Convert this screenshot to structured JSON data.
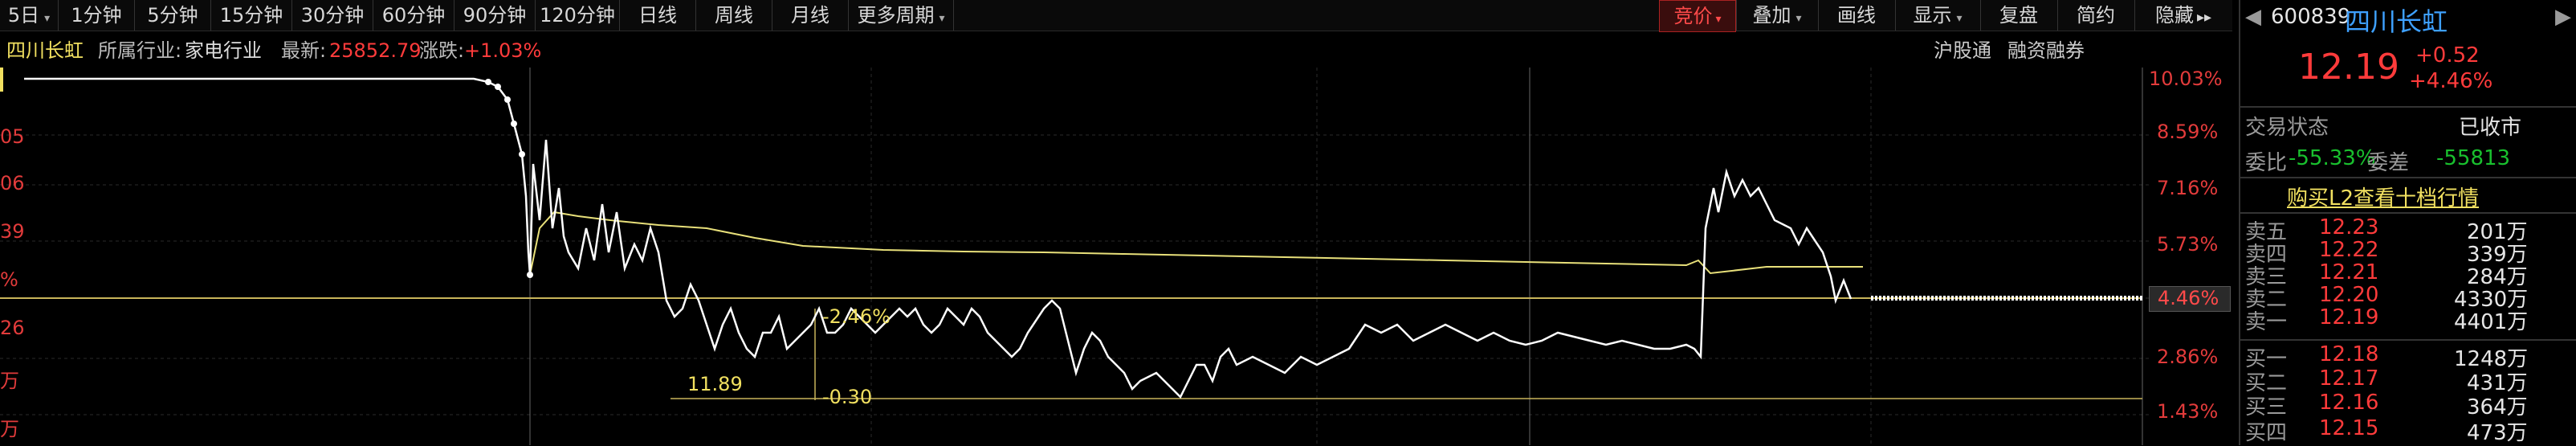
{
  "toolbar": {
    "periods": [
      "5日",
      "1分钟",
      "5分钟",
      "15分钟",
      "30分钟",
      "60分钟",
      "90分钟",
      "120分钟",
      "日线",
      "周线",
      "月线",
      "更多周期"
    ],
    "right_buttons": [
      "竞价",
      "叠加",
      "画线",
      "显示",
      "复盘",
      "简约",
      "隐藏"
    ]
  },
  "infobar": {
    "stock_name": "四川长虹",
    "industry_label": "所属行业:",
    "industry": "家电行业",
    "latest_label": "最新:",
    "latest": "25852.79",
    "change_label": "涨跌:",
    "change": "+1.03%",
    "right_links": [
      "沪股通",
      "融资融券"
    ]
  },
  "chart": {
    "right_axis": [
      "10.03%",
      "8.59%",
      "7.16%",
      "5.73%",
      "4.46%",
      "2.86%",
      "1.43%"
    ],
    "left_axis": [
      "05",
      "06",
      "39",
      "%",
      "26",
      "万",
      "万"
    ],
    "annotations": {
      "pct": "-2.46%",
      "low_price": "11.89",
      "delta": "-0.30"
    },
    "colors": {
      "price_line": "#ffffff",
      "avg_line": "#e8e07a",
      "axis_text": "#e23b3b"
    }
  },
  "panel": {
    "code": "600839",
    "name": "四川长虹",
    "price": "12.19",
    "change": "+0.52",
    "change_pct": "+4.46%",
    "status_label": "交易状态",
    "status": "已收市",
    "wb_label": "委比",
    "wb": "-55.33%",
    "wc_label": "委差",
    "wc": "-55813",
    "l2_link": "购买L2查看十档行情",
    "asks": [
      {
        "label": "卖五",
        "price": "12.23",
        "vol": "201万"
      },
      {
        "label": "卖四",
        "price": "12.22",
        "vol": "339万"
      },
      {
        "label": "卖三",
        "price": "12.21",
        "vol": "284万"
      },
      {
        "label": "卖二",
        "price": "12.20",
        "vol": "4330万"
      },
      {
        "label": "卖一",
        "price": "12.19",
        "vol": "4401万"
      }
    ],
    "bids": [
      {
        "label": "买一",
        "price": "12.18",
        "vol": "1248万"
      },
      {
        "label": "买二",
        "price": "12.17",
        "vol": "431万"
      },
      {
        "label": "买三",
        "price": "12.16",
        "vol": "364万"
      },
      {
        "label": "买四",
        "price": "12.15",
        "vol": "473万"
      }
    ]
  }
}
